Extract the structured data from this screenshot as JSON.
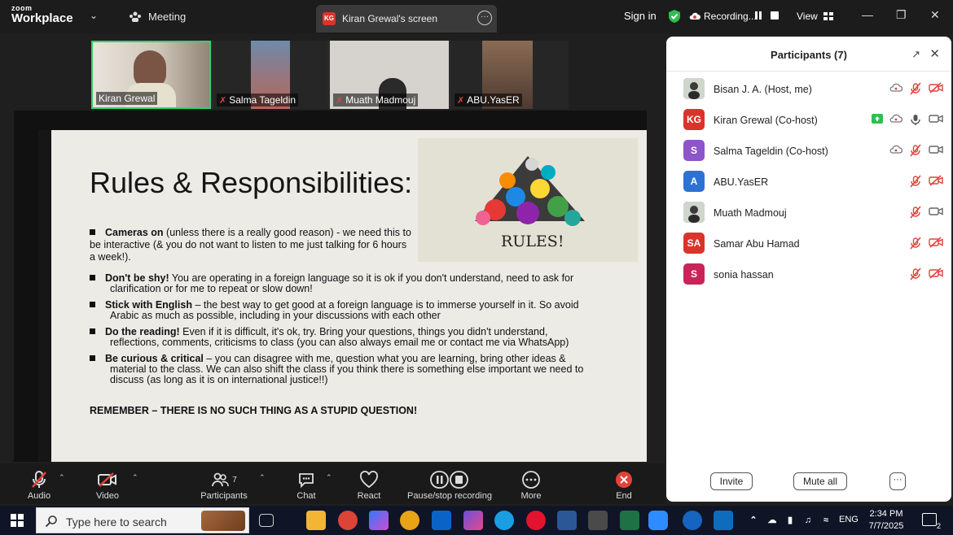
{
  "topbar": {
    "logo_line1": "zoom",
    "logo_line2": "Workplace",
    "meeting_label": "Meeting",
    "share_tab_initials": "KG",
    "share_tab_title": "Kiran Grewal's screen",
    "sign_in": "Sign in",
    "recording": "Recording...",
    "view": "View"
  },
  "thumbnails": [
    {
      "name": "Kiran Grewal"
    },
    {
      "name": "Salma Tageldin"
    },
    {
      "name": "Muath Madmouj"
    },
    {
      "name": "ABU.YasER"
    }
  ],
  "slide": {
    "title": "Rules & Responsibilities:",
    "image_label": "RULES!",
    "bullets": [
      {
        "bold": "Cameras on",
        "text": " (unless there is a really good reason) - we need this to",
        "line2": "be interactive (& you do not want to listen to me just  talking  for 6 hours",
        "line3": "a week!)."
      },
      {
        "bold": "Don't be shy!",
        "text": " You are operating in a foreign language so it is ok if you don't understand, need to ask for",
        "line2": "clarification or for me to repeat or slow down!"
      },
      {
        "bold": "Stick with English",
        "text": " – the best way to get good at a foreign language is to immerse yourself in it. So avoid",
        "line2": "Arabic as much as possible, including in your discussions with each other"
      },
      {
        "bold": "Do the reading!",
        "text": " Even if it is difficult, it's ok, try. Bring your questions, things you didn't understand,",
        "line2": "reflections, comments, criticisms to class (you can also always email me or contact me via WhatsApp)"
      },
      {
        "bold": "Be curious & critical",
        "text": " – you can disagree with me, question what you are learning, bring other ideas &",
        "line2": "material to the class. We can also shift the class if you think there is something else important we need to",
        "line3": "discuss (as long as it is on international justice!!)"
      }
    ],
    "remember": "REMEMBER  –  THERE IS NO SUCH THING AS A STUPID QUESTION!"
  },
  "panel": {
    "title": "Participants (7)",
    "participants": [
      {
        "initials": "",
        "name": "Bisan J. A. (Host, me)",
        "color": "#6b6b6b"
      },
      {
        "initials": "KG",
        "name": "Kiran Grewal (Co-host)",
        "color": "#d9342b"
      },
      {
        "initials": "S",
        "name": "Salma Tageldin (Co-host)",
        "color": "#8c55c9"
      },
      {
        "initials": "A",
        "name": "ABU.YasER",
        "color": "#2d72d2"
      },
      {
        "initials": "",
        "name": "Muath Madmouj",
        "color": "#3d4a5c"
      },
      {
        "initials": "SA",
        "name": "Samar Abu Hamad",
        "color": "#d9342b"
      },
      {
        "initials": "S",
        "name": "sonia hassan",
        "color": "#c9245a"
      }
    ],
    "invite": "Invite",
    "mute_all": "Mute all",
    "more": "···"
  },
  "toolbar": {
    "audio": "Audio",
    "video": "Video",
    "participants": "Participants",
    "participants_count": "7",
    "chat": "Chat",
    "react": "React",
    "pause_stop": "Pause/stop recording",
    "more": "More",
    "end": "End"
  },
  "taskbar": {
    "search_placeholder": "Type here to search",
    "lang": "ENG",
    "time": "2:34 PM",
    "date": "7/7/2025",
    "notifications": "2"
  },
  "colors": {
    "accent_red": "#e0433b",
    "panel_bg": "#ffffff",
    "toolbar_bg": "#1a1a1a",
    "taskbar_bg": "#0f1526"
  }
}
